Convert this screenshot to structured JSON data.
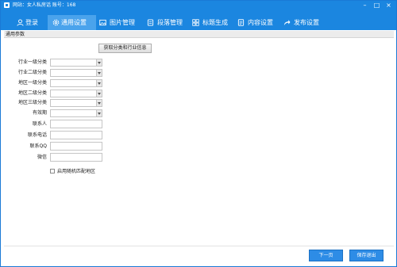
{
  "window": {
    "title": "网站：女人私房话 账号：168"
  },
  "nav": {
    "tabs": [
      {
        "label": "登录",
        "icon": "user-icon",
        "active": false
      },
      {
        "label": "通用设置",
        "icon": "gear-icon",
        "active": true
      },
      {
        "label": "图片管理",
        "icon": "image-icon",
        "active": false
      },
      {
        "label": "段落管理",
        "icon": "paragraph-icon",
        "active": false
      },
      {
        "label": "标题生成",
        "icon": "grid-icon",
        "active": false
      },
      {
        "label": "内容设置",
        "icon": "document-icon",
        "active": false
      },
      {
        "label": "发布设置",
        "icon": "share-arrow-icon",
        "active": false
      }
    ]
  },
  "section": {
    "title": "通用参数"
  },
  "form": {
    "fetch_button_label": "获取分类和行业信息",
    "selects": [
      {
        "label": "行业一级分类",
        "value": ""
      },
      {
        "label": "行业二级分类",
        "value": ""
      },
      {
        "label": "地区一级分类",
        "value": ""
      },
      {
        "label": "地区二级分类",
        "value": ""
      },
      {
        "label": "地区三级分类",
        "value": ""
      },
      {
        "label": "有效期",
        "value": ""
      }
    ],
    "inputs": [
      {
        "label": "联系人",
        "value": ""
      },
      {
        "label": "联系电话",
        "value": ""
      },
      {
        "label": "联系QQ",
        "value": ""
      },
      {
        "label": "微信",
        "value": ""
      }
    ],
    "checkbox_label": "启用随机匹配地区",
    "checkbox_checked": false
  },
  "footer": {
    "next_label": "下一页",
    "save_label": "保存退出"
  },
  "colors": {
    "accent": "#1b86e0",
    "active_tab": "#4aa3ec",
    "button": "#2d8ce6"
  }
}
